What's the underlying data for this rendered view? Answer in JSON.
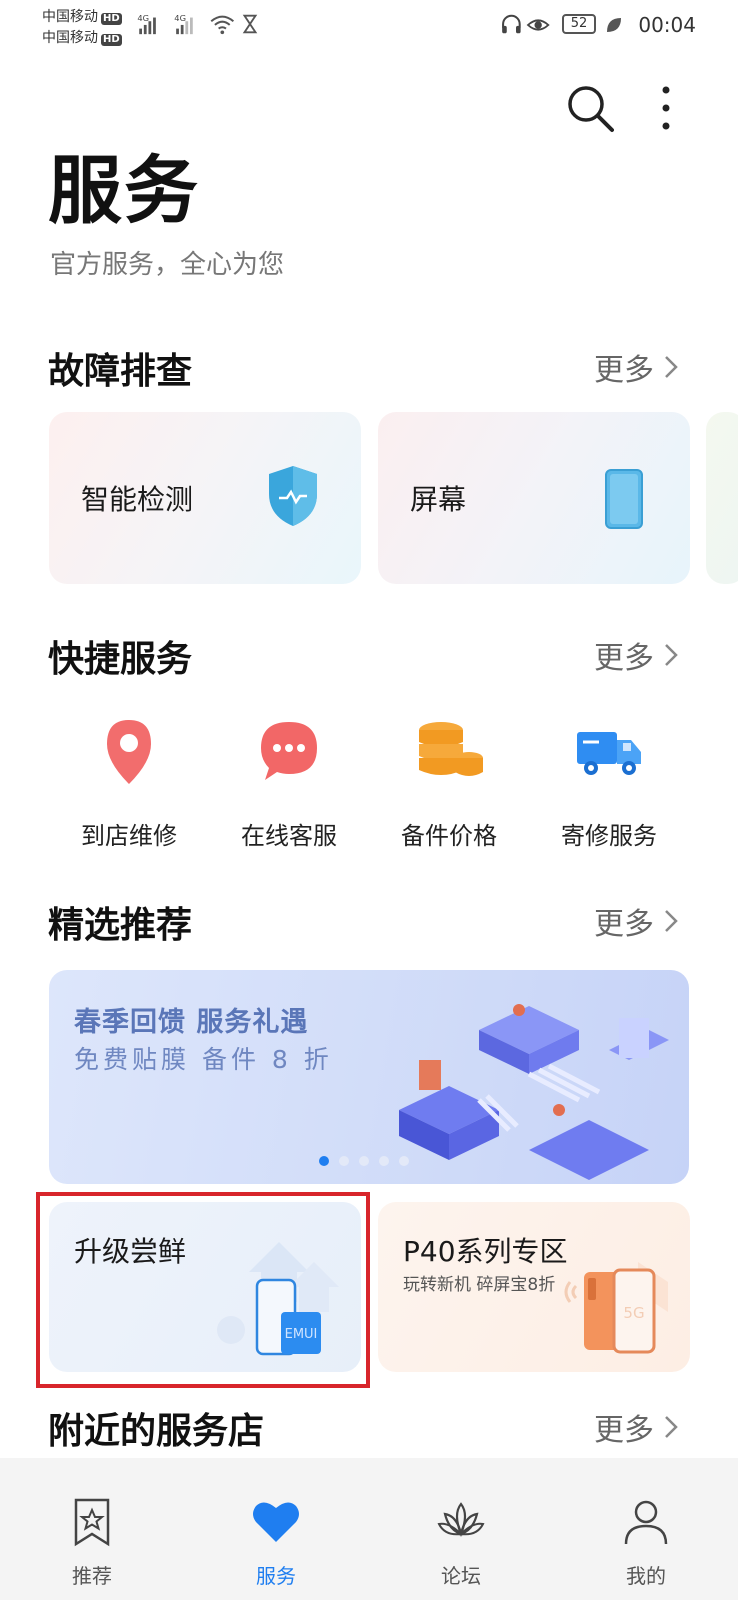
{
  "status_bar": {
    "carrier_1": "中国移动",
    "carrier_2": "中国移动",
    "hd_badge": "HD",
    "network_1": "4G",
    "network_2": "4G",
    "battery": "52",
    "time": "00:04"
  },
  "header": {
    "title": "服务",
    "subtitle": "官方服务，全心为您"
  },
  "troubleshoot": {
    "title": "故障排查",
    "more": "更多",
    "cards": [
      {
        "label": "智能检测",
        "icon": "shield-check-icon"
      },
      {
        "label": "屏幕",
        "icon": "phone-screen-icon"
      }
    ]
  },
  "quick_services": {
    "title": "快捷服务",
    "more": "更多",
    "items": [
      {
        "label": "到店维修",
        "icon": "location-pin-icon"
      },
      {
        "label": "在线客服",
        "icon": "chat-bubble-icon"
      },
      {
        "label": "备件价格",
        "icon": "coins-icon"
      },
      {
        "label": "寄修服务",
        "icon": "delivery-truck-icon"
      }
    ]
  },
  "featured": {
    "title": "精选推荐",
    "more": "更多",
    "banner": {
      "title": "春季回馈  服务礼遇",
      "subtitle": "免费贴膜  备件 8 折",
      "page_count": 5,
      "active_page": 1
    },
    "cards": [
      {
        "title": "升级尝鲜",
        "badge": "EMUI"
      },
      {
        "title": "P40系列专区",
        "subtitle": "玩转新机 碎屏宝8折",
        "badge": "5G"
      }
    ]
  },
  "nearby": {
    "title": "附近的服务店",
    "more": "更多"
  },
  "bottom_nav": [
    {
      "label": "推荐",
      "icon": "bookmark-star-icon",
      "active": false
    },
    {
      "label": "服务",
      "icon": "heart-icon",
      "active": true
    },
    {
      "label": "论坛",
      "icon": "lotus-icon",
      "active": false
    },
    {
      "label": "我的",
      "icon": "person-icon",
      "active": false
    }
  ],
  "colors": {
    "accent": "#1f7ef0",
    "highlight_border": "#d8252b",
    "banner_text": "#5a76b8"
  }
}
